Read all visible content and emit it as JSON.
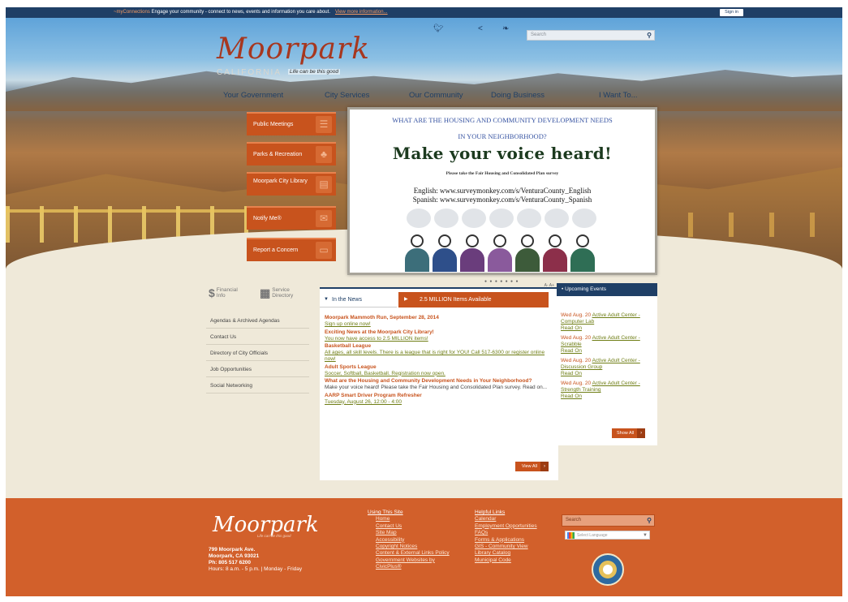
{
  "topbar": {
    "brand": "~myConnections",
    "message": " Engage your community - connect to news, events and information you care about.",
    "link": "View more information...",
    "signin": "Sign in"
  },
  "header": {
    "search_placeholder": "Search",
    "logo_word": "Moorpark",
    "logo_sub": "CALIFORNIA",
    "logo_tag": "Life can be this good"
  },
  "nav": {
    "items": [
      "Your Government",
      "City Services",
      "Our Community",
      "Doing Business",
      "I Want To..."
    ]
  },
  "quick_links": [
    "Public Meetings",
    "Parks & Recreation",
    "Moorpark City Library",
    "Notify Me®",
    "Report a Concern"
  ],
  "slide": {
    "line1": "WHAT ARE THE HOUSING AND COMMUNITY DEVELOPMENT NEEDS",
    "line2": "IN YOUR NEIGHBORHOOD?",
    "headline": "Make your voice heard!",
    "small": "Please take the Fair Housing and Consolidated Plan survey",
    "english": "English: www.surveymonkey.com/s/VenturaCounty_English",
    "spanish": "Spanish: www.surveymonkey.com/s/VenturaCounty_Spanish",
    "dots": "● ● ● ● ● ● ●"
  },
  "left_col": {
    "financial": "Financial Info",
    "service": "Service Directory",
    "links": [
      "Agendas & Archived Agendas",
      "Contact Us",
      "Directory of City Officials",
      "Job Opportunities",
      "Social Networking"
    ]
  },
  "news": {
    "tab1": "In the News",
    "tab2": "2.5 MILLION Items Available",
    "az": "A- A+",
    "items": [
      {
        "head": "Moorpark Mammoth Run, September 28, 2014",
        "link": "Sign up online now!",
        "text": ""
      },
      {
        "head": "Exciting News at the Moorpark City Library!",
        "link": "You now have access to 2.5 MILLION items!",
        "text": ""
      },
      {
        "head": "Basketball League",
        "link": "All ages, all skill levels. There is a league that is right for YOU! Call 517-6300 or register online now!",
        "text": ""
      },
      {
        "head": "Adult Sports League",
        "link": "Soccer, Softball, Basketball. Registration now open.",
        "text": ""
      },
      {
        "head": "What are the Housing and Community Development Needs in Your Neighborhood?",
        "link": "",
        "text": "Make your voice heard! Please take the Fair Housing and Consolidated Plan survey.  Read on..."
      },
      {
        "head": "AARP Smart Driver Program Refresher",
        "link": "Tuesday, August 26, 12:00 - 4:00",
        "text": ""
      }
    ],
    "view_all": "View All"
  },
  "events": {
    "header": "Upcoming Events",
    "items": [
      {
        "date": "Wed Aug. 20",
        "title": "Active Adult Center - Computer Lab",
        "read": "Read On"
      },
      {
        "date": "Wed Aug. 20",
        "title": "Active Adult Center - Scrabble",
        "read": "Read On"
      },
      {
        "date": "Wed Aug. 20",
        "title": "Active Adult Center - Discussion Group",
        "read": "Read On"
      },
      {
        "date": "Wed Aug. 20",
        "title": "Active Adult Center - Strength Training",
        "read": "Read On"
      }
    ],
    "show_all": "Show All"
  },
  "footer": {
    "logo_word": "Moorpark",
    "logo_tag": "Life can be this good",
    "address1": "799 Moorpark Ave.",
    "address2": "Moorpark, CA 93021",
    "phone": "Ph: 805 517 6200",
    "hours": "Hours: 8 a.m. - 5 p.m. | Monday - Friday",
    "col1_head": "Using This Site",
    "col1": [
      "Home",
      "Contact Us",
      "Site Map",
      "Accessibility",
      "Copyright Notices",
      "Content & External Links Policy",
      "Government Websites by CivicPlus®"
    ],
    "col2_head": "Helpful Links",
    "col2": [
      "Calendar",
      "Employment Opportunities",
      "FAQs",
      "Forms & Applications",
      "GIS - Community View",
      "Library Catalog",
      "Municipal Code"
    ],
    "search_placeholder": "Search",
    "translate": "Select Language"
  }
}
